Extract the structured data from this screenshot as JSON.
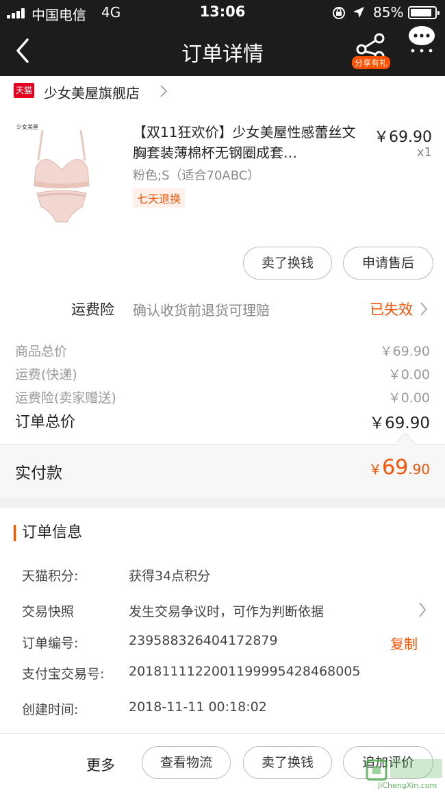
{
  "status_bar": {
    "carrier": "中国电信",
    "network": "4G",
    "time": "13:06",
    "battery_pct": "85%"
  },
  "nav": {
    "title": "订单详情",
    "share_badge": "分享有礼"
  },
  "store": {
    "logo_text": "天猫",
    "name": "少女美屋旗舰店"
  },
  "product": {
    "brand_mark": "少女美屋",
    "title": "【双11狂欢价】少女美屋性感蕾丝文胸套装薄棉杯无钢圈成套…",
    "spec": "粉色;S（适合70ABC）",
    "tag": "七天退换",
    "price": "￥69.90",
    "qty": "x1",
    "actions": [
      "卖了换钱",
      "申请售后"
    ]
  },
  "insurance": {
    "label": "运费险",
    "desc": "确认收货前退货可理赔",
    "status": "已失效"
  },
  "prices": {
    "rows": [
      {
        "label": "商品总价",
        "value": "￥69.90"
      },
      {
        "label": "运费(快递)",
        "value": "￥0.00"
      },
      {
        "label": "运费险(卖家赠送)",
        "value": "￥0.00"
      }
    ],
    "total_label": "订单总价",
    "total_value": "￥69.90",
    "paid_label": "实付款",
    "paid_currency": "￥",
    "paid_int": "69",
    "paid_dec": ".90"
  },
  "order_info": {
    "title": "订单信息",
    "rows": [
      {
        "label": "天猫积分:",
        "value": "获得34点积分"
      },
      {
        "label": "交易快照",
        "value": "发生交易争议时，可作为判断依据"
      },
      {
        "label": "订单编号:",
        "value": "239588326404172879"
      },
      {
        "label": "支付宝交易号:",
        "value": "2018111122001199995428468005"
      },
      {
        "label": "创建时间:",
        "value": "2018-11-11 00:18:02"
      }
    ],
    "copy_label": "复制"
  },
  "bottom_bar": {
    "more_label": "更多",
    "buttons": [
      "查看物流",
      "卖了换钱",
      "追加评价"
    ]
  },
  "watermark": {
    "text": "JiChengXin.com"
  },
  "colors": {
    "accent": "#ff5000",
    "header_bg": "#1c1c1c",
    "tmall_red": "#e4001e"
  }
}
